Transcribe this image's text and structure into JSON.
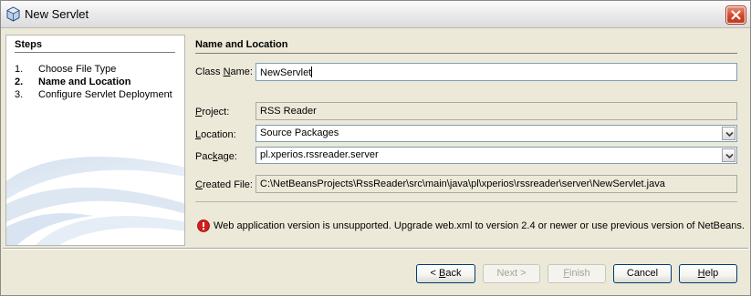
{
  "window": {
    "title": "New Servlet",
    "close_icon": "close-icon",
    "app_icon": "netbeans-cube-icon"
  },
  "steps": {
    "title": "Steps",
    "items": [
      {
        "num": "1.",
        "label": "Choose File Type",
        "current": false
      },
      {
        "num": "2.",
        "label": "Name and Location",
        "current": true
      },
      {
        "num": "3.",
        "label": "Configure Servlet Deployment",
        "current": false
      }
    ]
  },
  "form": {
    "section_title": "Name and Location",
    "class_name": {
      "label_pre": "Class ",
      "label_key": "N",
      "label_post": "ame:",
      "value": "NewServlet"
    },
    "project": {
      "label_pre": "",
      "label_key": "P",
      "label_post": "roject:",
      "value": "RSS Reader"
    },
    "location": {
      "label_pre": "",
      "label_key": "L",
      "label_post": "ocation:",
      "value": "Source Packages"
    },
    "package": {
      "label_pre": "Pac",
      "label_key": "k",
      "label_post": "age:",
      "value": "pl.xperios.rssreader.server"
    },
    "created_file": {
      "label_pre": "",
      "label_key": "C",
      "label_post": "reated File:",
      "value": "C:\\NetBeansProjects\\RssReader\\src\\main\\java\\pl\\xperios\\rssreader\\server\\NewServlet.java"
    }
  },
  "error": {
    "icon": "error-icon",
    "message": "Web application version is unsupported. Upgrade web.xml to version 2.4 or newer or use previous version of NetBeans."
  },
  "buttons": {
    "back": {
      "pre": "< ",
      "key": "B",
      "post": "ack"
    },
    "next": {
      "label": "Next >"
    },
    "finish": {
      "pre": "",
      "key": "F",
      "post": "inish"
    },
    "cancel": {
      "label": "Cancel"
    },
    "help": {
      "pre": "",
      "key": "H",
      "post": "elp"
    }
  },
  "colors": {
    "error": "#d41c1c",
    "button_border": "#003c74",
    "field_border": "#7f9db9",
    "dialog_bg": "#ece9d8"
  }
}
